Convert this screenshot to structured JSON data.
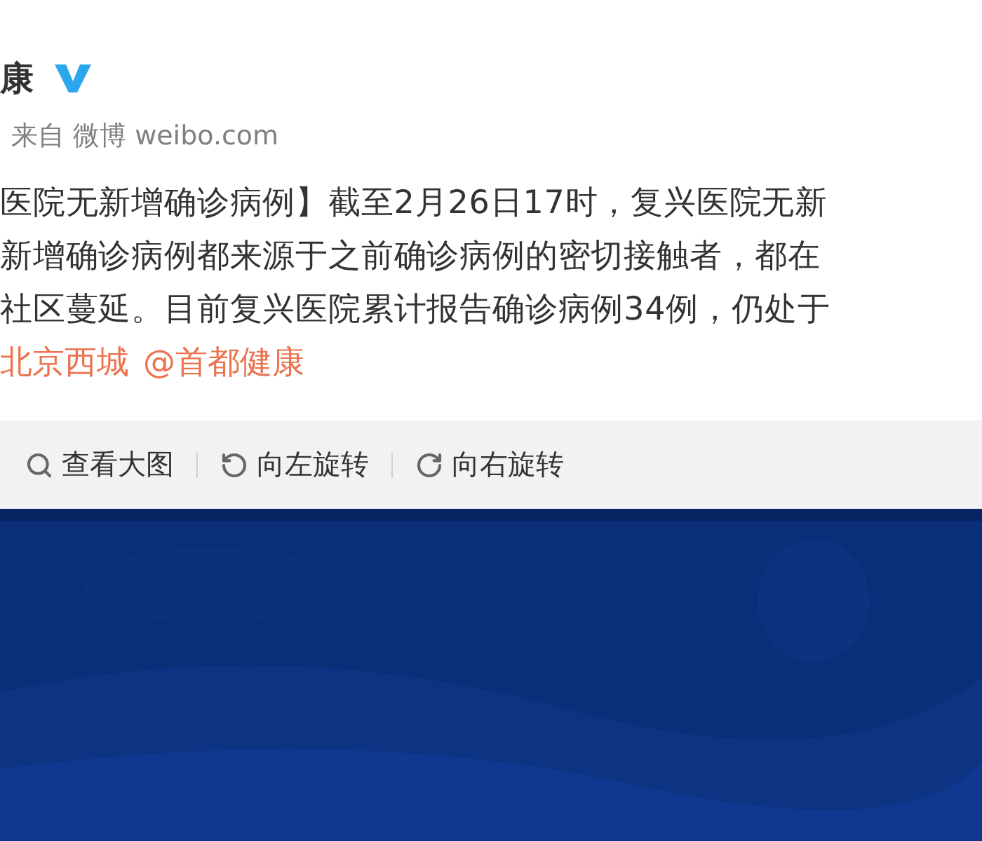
{
  "post": {
    "author": "康",
    "verified": true,
    "source": "来自 微博 weibo.com",
    "lines": [
      "医院无新增确诊病例】截至2月26日17时，复兴医院无新",
      "新增确诊病例都来源于之前确诊病例的密切接触者，都在",
      "社区蔓延。目前复兴医院累计报告确诊病例34例，仍处于"
    ],
    "links": [
      "北京西城",
      "@首都健康"
    ]
  },
  "image_toolbar": [
    {
      "kind": "zoom",
      "label": "查看大图"
    },
    {
      "kind": "rotate-left",
      "label": "向左旋转"
    },
    {
      "kind": "rotate-right",
      "label": "向右旋转"
    }
  ]
}
